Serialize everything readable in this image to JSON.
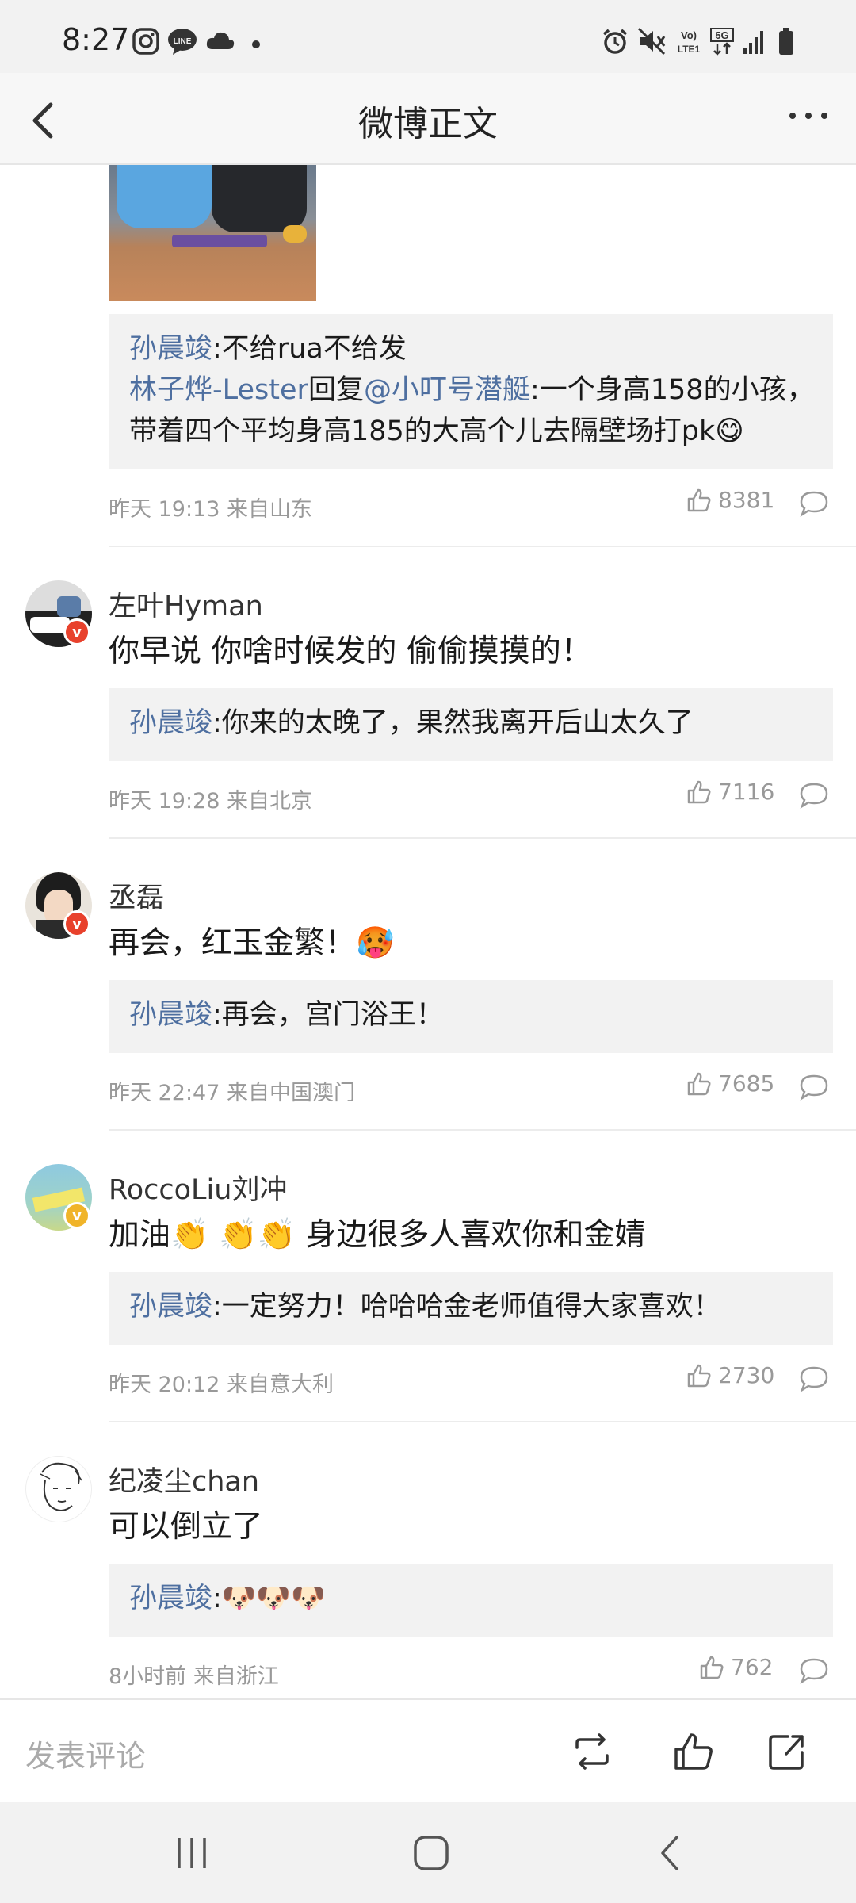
{
  "status_bar": {
    "time": "8:27"
  },
  "nav": {
    "title": "微博正文"
  },
  "comments": [
    {
      "reply": {
        "line1_name": "孙晨竣",
        "line1_text": ":不给rua不给发",
        "line2_name": "林子烨-Lester",
        "line2_mid": "回复",
        "line2_mention": "@小叮号潜艇",
        "line2_text": ":一个身高158的小孩，",
        "line3_text": "带着四个平均身高185的大高个儿去隔壁场打pk😋"
      },
      "meta": "昨天 19:13 来自山东",
      "likes": "8381"
    },
    {
      "username": "左叶Hyman",
      "text": "你早说 你啥时候发的 偷偷摸摸的！",
      "reply_name": "孙晨竣",
      "reply_text": ":你来的太晚了，果然我离开后山太久了",
      "meta": "昨天 19:28 来自北京",
      "likes": "7116"
    },
    {
      "username": "丞磊",
      "text": "再会，红玉金繁！🥵",
      "reply_name": "孙晨竣",
      "reply_text": ":再会，宫门浴王！",
      "meta": "昨天 22:47 来自中国澳门",
      "likes": "7685"
    },
    {
      "username": "RoccoLiu刘冲",
      "text": "加油👏 👏👏 身边很多人喜欢你和金婧",
      "reply_name": "孙晨竣",
      "reply_text": ":一定努力！哈哈哈金老师值得大家喜欢！",
      "meta": "昨天 20:12 来自意大利",
      "likes": "2730"
    },
    {
      "username": "纪凌尘chan",
      "text": "可以倒立了",
      "reply_name": "孙晨竣",
      "reply_text": ":🐶🐶🐶",
      "meta": "8小时前 来自浙江",
      "likes": "762"
    }
  ],
  "action_bar": {
    "placeholder": "发表评论"
  },
  "colors": {
    "link": "#4e6fa0",
    "verified_red": "#e8412c",
    "verified_gold": "#f0b429"
  }
}
